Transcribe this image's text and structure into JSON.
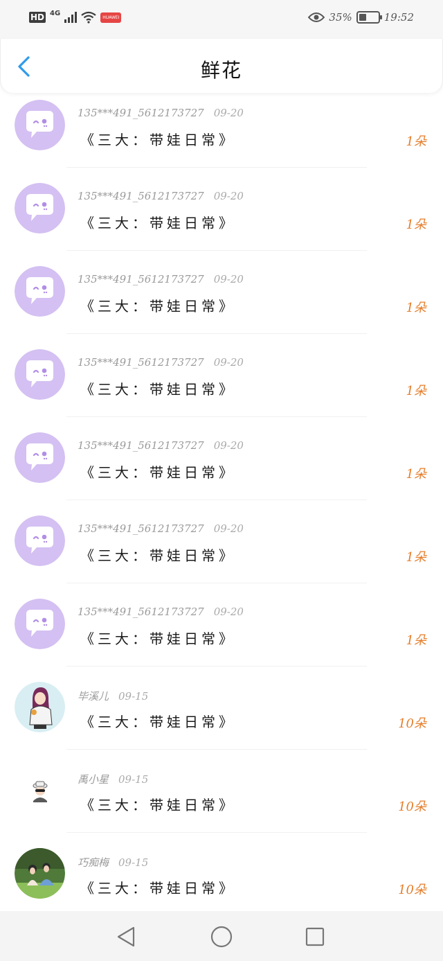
{
  "status_bar": {
    "hd": "HD",
    "network": "4G",
    "battery_percent": "35%",
    "time": "19:52",
    "icons": [
      "signal-icon",
      "wifi-icon",
      "huawei-app-icon",
      "eye-icon",
      "battery-icon"
    ]
  },
  "header": {
    "title": "鲜花",
    "back_icon": "chevron-left-icon",
    "accent_color": "#2f9bea"
  },
  "gifts": [
    {
      "user": "135***491_5612173727",
      "date": "09-20",
      "title": "《三大：带娃日常》",
      "amount": "1朵",
      "avatar": "chat-bubble"
    },
    {
      "user": "135***491_5612173727",
      "date": "09-20",
      "title": "《三大：带娃日常》",
      "amount": "1朵",
      "avatar": "chat-bubble"
    },
    {
      "user": "135***491_5612173727",
      "date": "09-20",
      "title": "《三大：带娃日常》",
      "amount": "1朵",
      "avatar": "chat-bubble"
    },
    {
      "user": "135***491_5612173727",
      "date": "09-20",
      "title": "《三大：带娃日常》",
      "amount": "1朵",
      "avatar": "chat-bubble"
    },
    {
      "user": "135***491_5612173727",
      "date": "09-20",
      "title": "《三大：带娃日常》",
      "amount": "1朵",
      "avatar": "chat-bubble"
    },
    {
      "user": "135***491_5612173727",
      "date": "09-20",
      "title": "《三大：带娃日常》",
      "amount": "1朵",
      "avatar": "chat-bubble"
    },
    {
      "user": "135***491_5612173727",
      "date": "09-20",
      "title": "《三大：带娃日常》",
      "amount": "1朵",
      "avatar": "chat-bubble"
    },
    {
      "user": "毕溪儿",
      "date": "09-15",
      "title": "《三大：带娃日常》",
      "amount": "10朵",
      "avatar": "girl-illustration"
    },
    {
      "user": "禹小星",
      "date": "09-15",
      "title": "《三大：带娃日常》",
      "amount": "10朵",
      "avatar": "cool-kid"
    },
    {
      "user": "巧痴梅",
      "date": "09-15",
      "title": "《三大：带娃日常》",
      "amount": "10朵",
      "avatar": "couple-photo"
    }
  ],
  "colors": {
    "amount": "#e57e2b",
    "bubble_avatar_bg": "#d4c0f2",
    "bubble_eye": "#b28ee6"
  },
  "bottom_nav": {
    "icons": [
      "back-triangle-icon",
      "home-circle-icon",
      "recents-square-icon"
    ]
  }
}
